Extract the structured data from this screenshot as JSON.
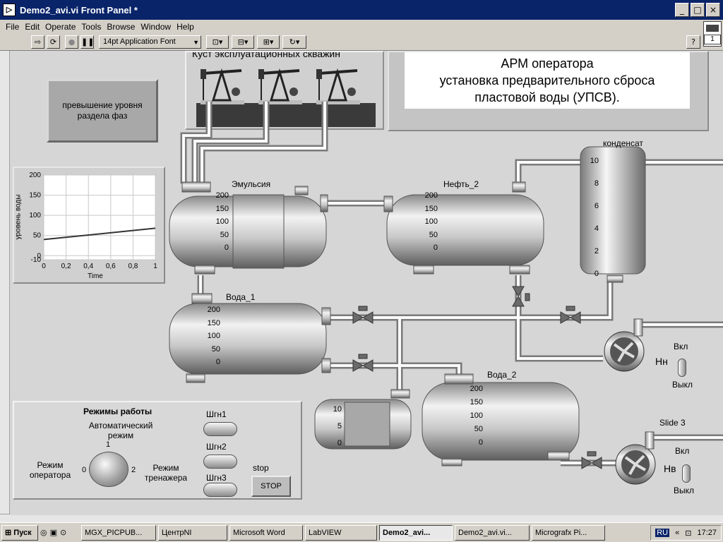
{
  "window": {
    "title": "Demo2_avi.vi Front Panel *",
    "app_icon": "▷",
    "controls": [
      "_",
      "□",
      "×"
    ]
  },
  "menu": [
    "File",
    "Edit",
    "Operate",
    "Tools",
    "Browse",
    "Window",
    "Help"
  ],
  "toolbar": {
    "font_select": "14pt Application Font",
    "help_label": "?"
  },
  "panel": {
    "alarm_button": "превышение уровня раздела фаз",
    "wells_title": "Куст эксплуатационных скважин",
    "title_lines": [
      "АРМ оператора",
      "установка предварительного сброса",
      "пластовой воды (УПСВ)."
    ],
    "chart": {
      "ylabel": "уровень воды",
      "xlabel": "Time"
    },
    "tanks": {
      "emulsion": "Эмульсия",
      "oil2": "Нефть_2",
      "condensate": "конденсат",
      "water1": "Вода_1",
      "water2": "Вода_2"
    },
    "tank_ticks_200": [
      "200",
      "150",
      "100",
      "50",
      "0"
    ],
    "tank_ticks_10": [
      "10",
      "8",
      "6",
      "4",
      "2",
      "0"
    ],
    "tank_ticks_10s": [
      "10",
      "5",
      "0"
    ],
    "pump1": {
      "name": "Нн",
      "on": "Вкл",
      "off": "Выкл"
    },
    "pump2": {
      "name": "Нв",
      "on": "Вкл",
      "off": "Выкл",
      "slide_label": "Slide 3"
    },
    "modes": {
      "title": "Режимы работы",
      "auto": "Автоматический режим",
      "auto_value": "1",
      "operator": "Режим оператора",
      "operator_value": "0",
      "trainer": "Режим тренажера",
      "trainer_value": "2",
      "well_buttons": [
        "Шгн1",
        "Шгн2",
        "Шгн3"
      ],
      "stop_label": "stop",
      "stop_button": "STOP"
    }
  },
  "taskbar": {
    "start": "Пуск",
    "items": [
      "MGX_PICPUB...",
      "ЦентрNI",
      "Microsoft Word",
      "LabVIEW",
      "Demo2_avi...",
      "Demo2_avi.vi...",
      "Micrografx Pi..."
    ],
    "lang": "RU",
    "time": "17:27"
  },
  "colors": {
    "titlebar": "#0a246a",
    "panel_bg": "#d6d6d6",
    "chart_bg": "#ffffff"
  },
  "chart_data": {
    "type": "line",
    "ylabel": "уровень воды",
    "xlabel": "Time",
    "xlim": [
      0,
      1
    ],
    "ylim": [
      -10,
      200
    ],
    "x_ticks": [
      "0",
      "0,2",
      "0,4",
      "0,6",
      "0,8",
      "1"
    ],
    "y_ticks": [
      "200",
      "150",
      "100",
      "50",
      "0",
      "-10"
    ],
    "series": [
      {
        "x": [
          0,
          1
        ],
        "y": [
          40,
          68
        ]
      }
    ],
    "grid": true
  }
}
